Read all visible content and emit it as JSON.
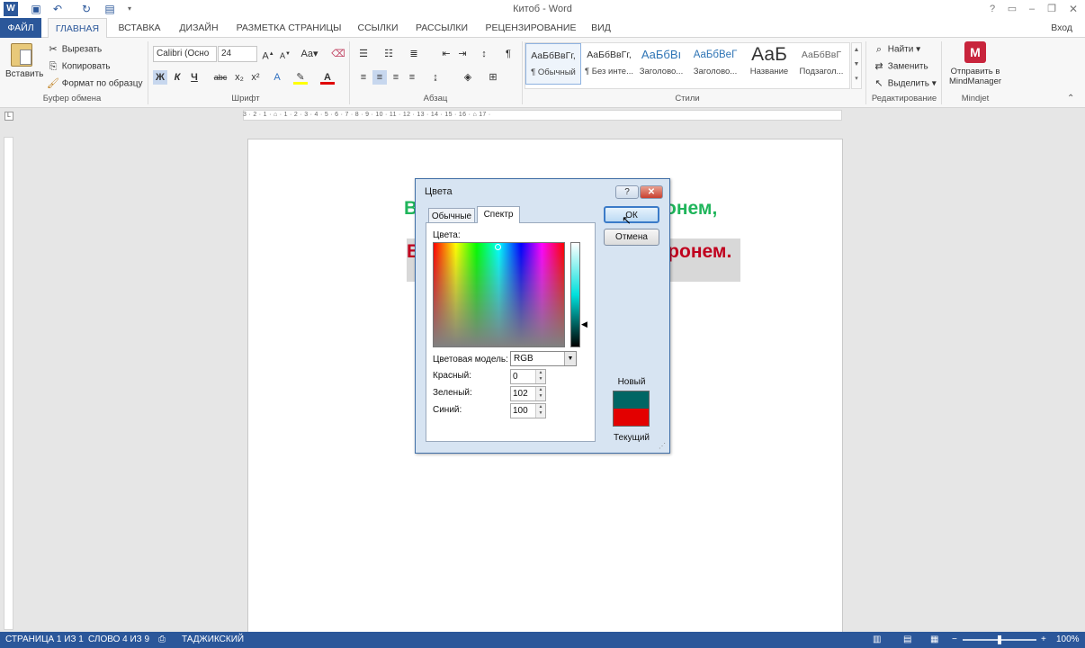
{
  "window": {
    "title": "Китоб - Word",
    "sign_in": "Вход"
  },
  "tabs": [
    "ФАЙЛ",
    "ГЛАВНАЯ",
    "ВСТАВКА",
    "ДИЗАЙН",
    "РАЗМЕТКА СТРАНИЦЫ",
    "ССЫЛКИ",
    "РАССЫЛКИ",
    "РЕЦЕНЗИРОВАНИЕ",
    "ВИД"
  ],
  "clipboard": {
    "paste": "Вставить",
    "cut": "Вырезать",
    "copy": "Копировать",
    "format_painter": "Формат по образцу",
    "group": "Буфер обмена"
  },
  "font": {
    "name": "Calibri (Осно",
    "size": "24",
    "bold": "Ж",
    "italic": "К",
    "underline": "Ч",
    "strike": "abc",
    "sub": "x₂",
    "sup": "x²",
    "group": "Шрифт"
  },
  "paragraph": {
    "group": "Абзац"
  },
  "styles": {
    "group": "Стили",
    "items": [
      {
        "preview": "АаБбВвГг,",
        "name": "¶ Обычный"
      },
      {
        "preview": "АаБбВвГг,",
        "name": "¶ Без инте..."
      },
      {
        "preview": "АаБбВı",
        "name": "Заголово..."
      },
      {
        "preview": "АаБбВеГ",
        "name": "Заголово..."
      },
      {
        "preview": "АаБ",
        "name": "Название"
      },
      {
        "preview": "АаБбВвГ",
        "name": "Подзагол..."
      }
    ]
  },
  "editing": {
    "find": "Найти",
    "replace": "Заменить",
    "select": "Выделить",
    "group": "Редактирование"
  },
  "mindjet": {
    "send": "Отправить в",
    "send2": "MindManager",
    "group": "Mindjet"
  },
  "ruler": {
    "marks": "3 · 2 · 1 · ⌂ · 1 · 2 · 3 · 4 · 5 · 6 · 7 · 8 · 9 · 10 · 11 · 12 · 13 · 14 · 15 · 16 · ⌂ 17 ·"
  },
  "document": {
    "line1_start": "В",
    "line1_end": "ронем,",
    "line2_start": "В",
    "line2_end": "ронем."
  },
  "dialog": {
    "title": "Цвета",
    "help": "?",
    "close": "✕",
    "tab_standard": "Обычные",
    "tab_custom": "Спектр",
    "colors_label": "Цвета:",
    "model_label": "Цветовая модель:",
    "model_value": "RGB",
    "red_label": "Красный:",
    "red_value": "0",
    "green_label": "Зеленый:",
    "green_value": "102",
    "blue_label": "Синий:",
    "blue_value": "100",
    "ok": "ОК",
    "cancel": "Отмена",
    "new_label": "Новый",
    "current_label": "Текущий",
    "new_color": "#006664",
    "current_color": "#e30000"
  },
  "status": {
    "page": "СТРАНИЦА 1 ИЗ 1",
    "words": "СЛОВО 4 ИЗ 9",
    "language": "ТАДЖИКСКИЙ",
    "zoom": "100%"
  }
}
